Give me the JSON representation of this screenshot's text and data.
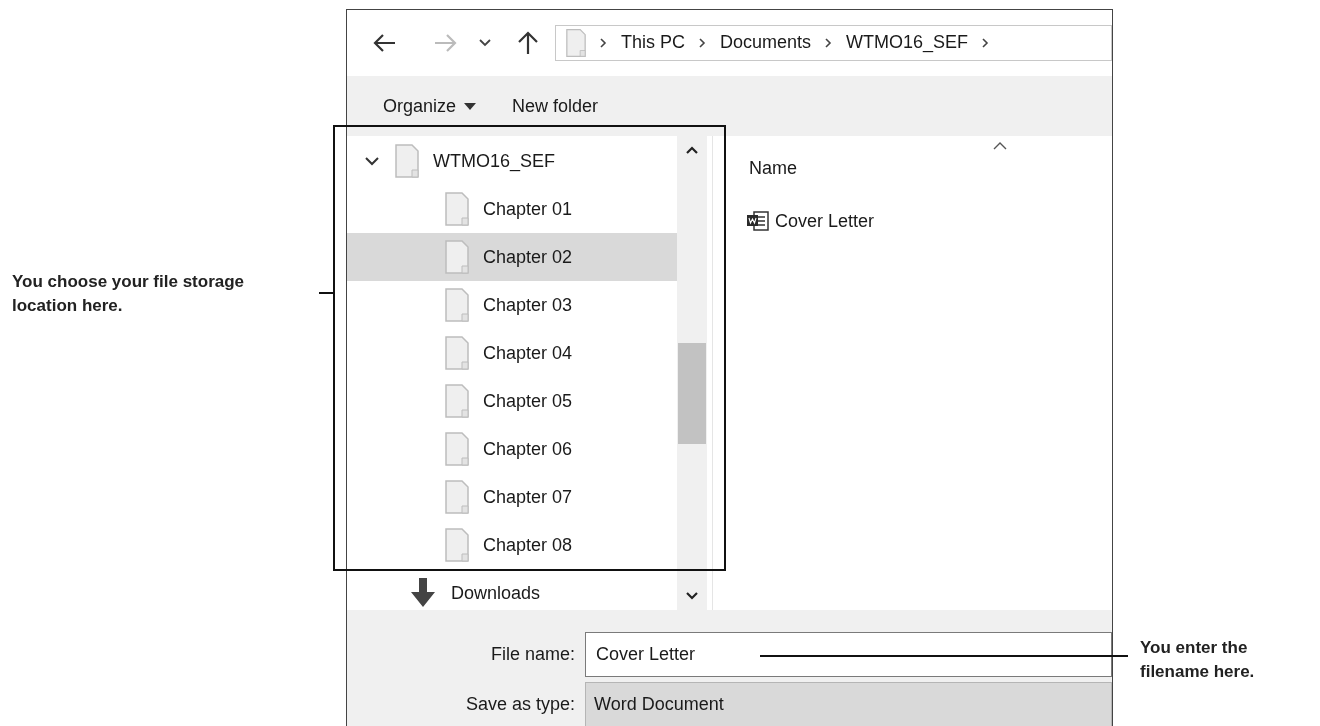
{
  "address_bar": {
    "crumbs": [
      "This PC",
      "Documents",
      "WTMO16_SEF"
    ]
  },
  "toolbar": {
    "organize": "Organize",
    "new_folder": "New folder"
  },
  "navigation_tree": [
    {
      "label": "WTMO16_SEF",
      "kind": "folder",
      "expanded": true,
      "selected": false,
      "children": [
        {
          "label": "Chapter 01",
          "kind": "folder",
          "selected": false
        },
        {
          "label": "Chapter 02",
          "kind": "folder",
          "selected": true
        },
        {
          "label": "Chapter 03",
          "kind": "folder",
          "selected": false
        },
        {
          "label": "Chapter 04",
          "kind": "folder",
          "selected": false
        },
        {
          "label": "Chapter 05",
          "kind": "folder",
          "selected": false
        },
        {
          "label": "Chapter 06",
          "kind": "folder",
          "selected": false
        },
        {
          "label": "Chapter 07",
          "kind": "folder",
          "selected": false
        },
        {
          "label": "Chapter 08",
          "kind": "folder",
          "selected": false
        }
      ]
    },
    {
      "label": "Downloads",
      "kind": "downloads",
      "selected": false
    }
  ],
  "file_list": {
    "columns": [
      "Name"
    ],
    "files": [
      {
        "name": "Cover Letter",
        "kind": "word"
      }
    ]
  },
  "file_name": {
    "label": "File name:",
    "value": "Cover Letter"
  },
  "save_as_type": {
    "label": "Save as type:",
    "value": "Word Document"
  },
  "callouts": [
    {
      "text": "You choose your file storage location here."
    },
    {
      "text": "You enter the filename here."
    }
  ]
}
